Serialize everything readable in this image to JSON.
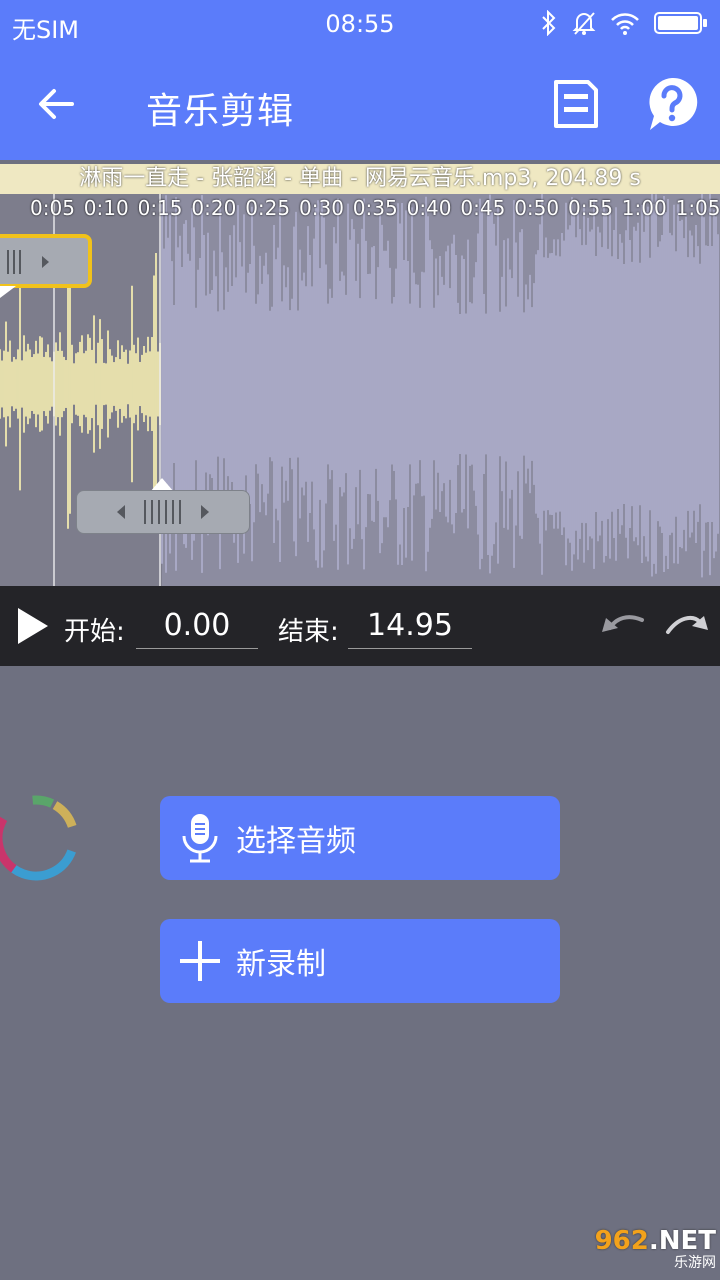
{
  "status_bar": {
    "carrier": "无SIM",
    "time": "08:55",
    "icons": [
      "bluetooth-icon",
      "mute-bell-icon",
      "wifi-icon",
      "battery-icon"
    ]
  },
  "app_bar": {
    "title": "音乐剪辑",
    "icons": [
      "back-arrow-icon",
      "save-icon",
      "help-icon"
    ]
  },
  "file_info": "淋雨一直走 - 张韶涵 - 单曲 - 网易云音乐.mp3, 204.89 s",
  "timeline_ticks": [
    "0:05",
    "0:10",
    "0:15",
    "0:20",
    "0:25",
    "0:30",
    "0:35",
    "0:40",
    "0:45",
    "0:50",
    "0:55",
    "1:00",
    "1:05"
  ],
  "controls": {
    "start_label": "开始:",
    "start_value": "0.00",
    "end_label": "结束:",
    "end_value": "14.95"
  },
  "buttons": {
    "select_audio": "选择音频",
    "new_record": "新录制"
  },
  "watermark": {
    "brand_digits": "962",
    "brand_suffix": ".NET",
    "brand_sub": "乐游网"
  },
  "colors": {
    "primary": "#5b7cfa",
    "selected_wave": "#fff6b5",
    "unselected_wave": "#b0b0ce",
    "handle_border": "#f1c21b",
    "control_bar": "#242428"
  }
}
